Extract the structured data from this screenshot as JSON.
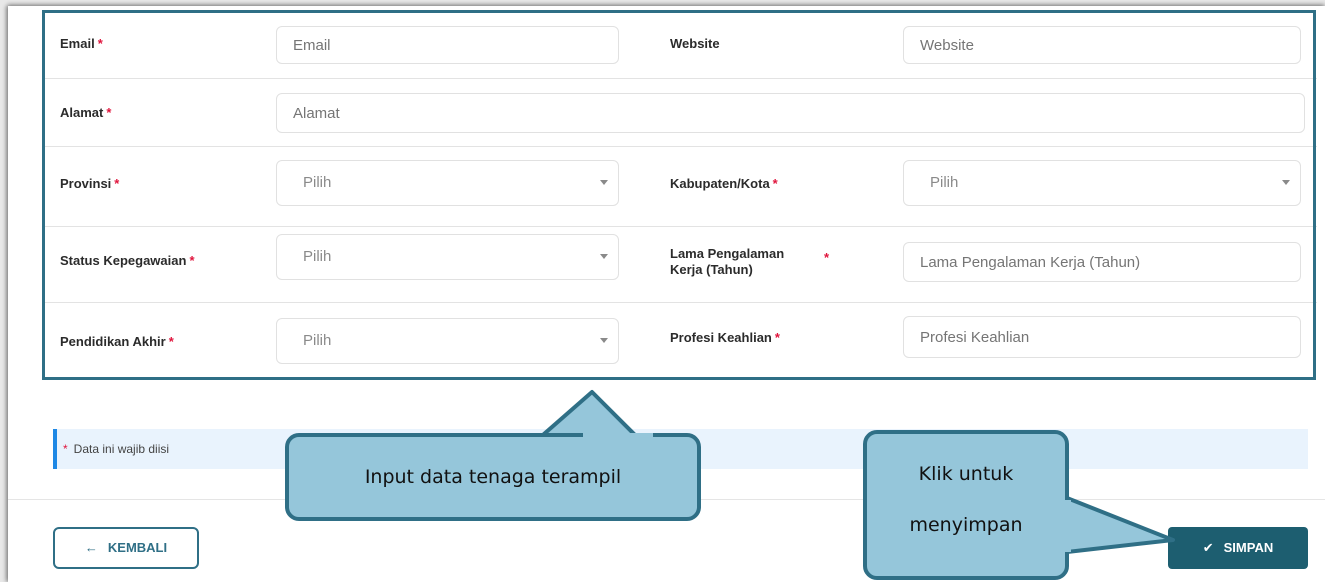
{
  "form": {
    "email": {
      "label": "Email",
      "required": "*",
      "placeholder": "Email"
    },
    "website": {
      "label": "Website",
      "placeholder": "Website"
    },
    "alamat": {
      "label": "Alamat",
      "required": "*",
      "placeholder": "Alamat"
    },
    "provinsi": {
      "label": "Provinsi",
      "required": "*",
      "value": "Pilih"
    },
    "kabupaten": {
      "label": "Kabupaten/Kota",
      "required": "*",
      "value": "Pilih"
    },
    "status": {
      "label": "Status Kepegawaian",
      "required": "*",
      "value": "Pilih"
    },
    "lama": {
      "label": "Lama Pengalaman Kerja (Tahun)",
      "required": "*",
      "placeholder": "Lama Pengalaman Kerja (Tahun)"
    },
    "pendidikan": {
      "label": "Pendidikan Akhir",
      "required": "*",
      "value": "Pilih"
    },
    "profesi": {
      "label": "Profesi Keahlian",
      "required": "*",
      "placeholder": "Profesi Keahlian"
    }
  },
  "info": {
    "marker": "*",
    "text": "Data ini wajib diisi"
  },
  "buttons": {
    "back": {
      "icon": "arrow-left-icon",
      "label": "KEMBALI"
    },
    "save": {
      "icon": "check-icon",
      "label": "SIMPAN"
    }
  },
  "callouts": {
    "input": "Input data tenaga terampil",
    "save_line1": "Klik untuk",
    "save_line2": "menyimpan"
  },
  "colors": {
    "accent": "#2f6f86",
    "required": "#e0143c",
    "save_button": "#1d5e70",
    "callout_fill": "#95c6da"
  }
}
